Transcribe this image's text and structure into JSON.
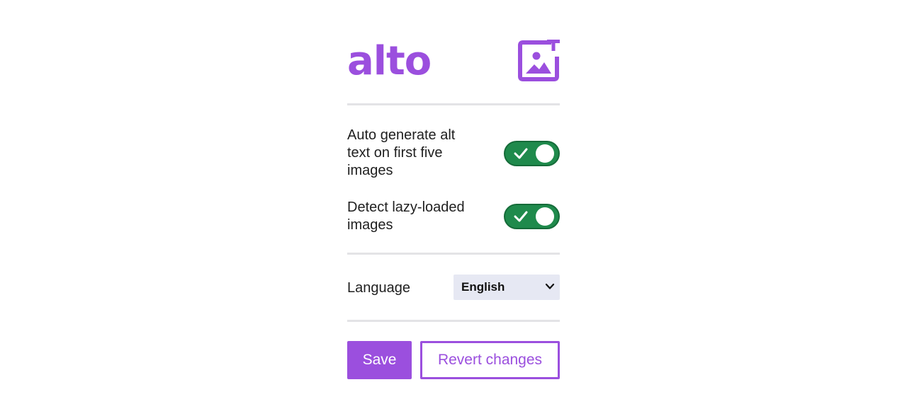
{
  "colors": {
    "accent": "#9b4fde",
    "toggle_on": "#1f8a4c",
    "toggle_border": "#156b39"
  },
  "header": {
    "logo_text": "alto",
    "logo_icon": "image-alt-text-icon"
  },
  "settings": [
    {
      "label": "Auto generate alt text on first five images",
      "enabled": true,
      "icon": "checkmark-icon"
    },
    {
      "label": "Detect lazy-loaded images",
      "enabled": true,
      "icon": "checkmark-icon"
    }
  ],
  "language": {
    "label": "Language",
    "selected": "English",
    "icon": "chevron-down-icon"
  },
  "actions": {
    "save_label": "Save",
    "revert_label": "Revert changes"
  }
}
